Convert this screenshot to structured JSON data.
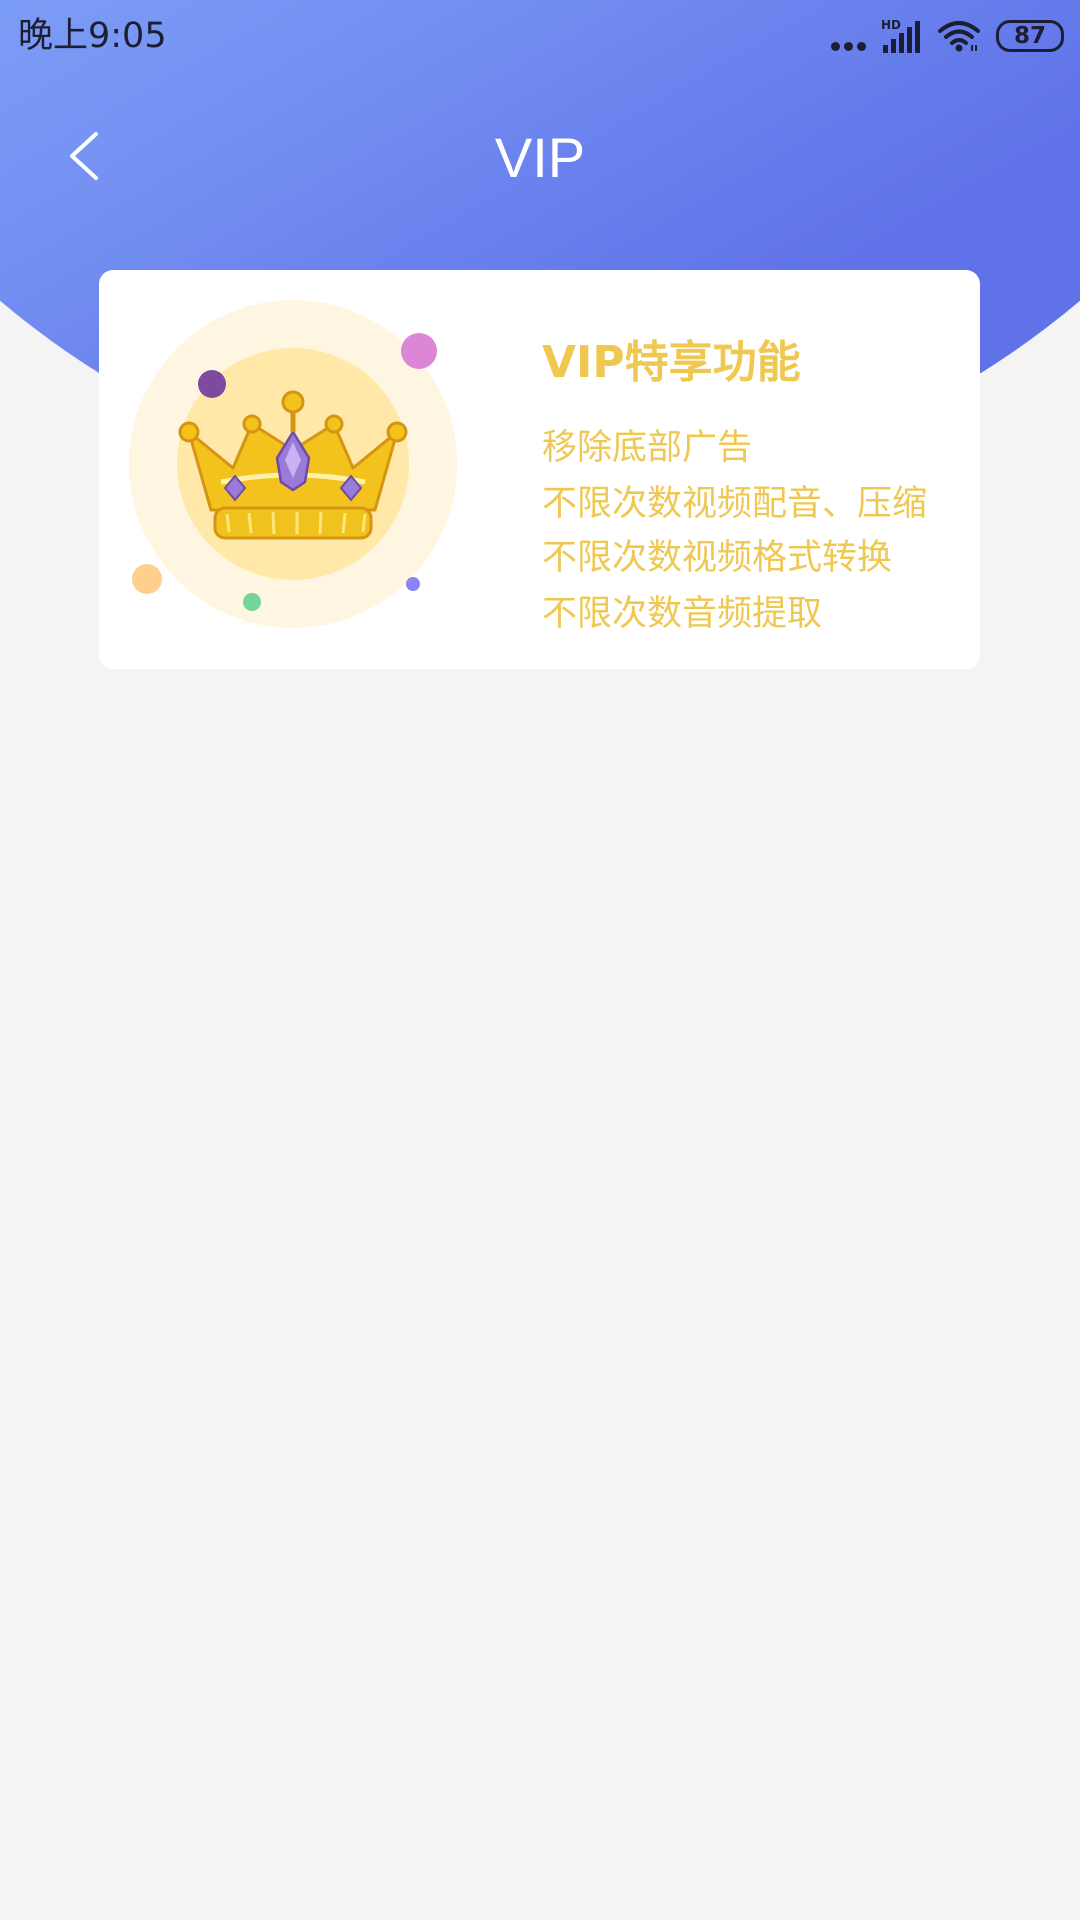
{
  "status_bar": {
    "time": "晚上9:05",
    "network_label": "HD",
    "battery_level": "87",
    "icons": [
      "more-dots-icon",
      "signal-icon",
      "wifi-icon",
      "battery-icon"
    ]
  },
  "nav": {
    "back_icon": "chevron-left-icon",
    "title": "VIP"
  },
  "vip_card": {
    "illustration": "crown-icon",
    "title": "VIP特享功能",
    "benefits": [
      "移除底部广告",
      "不限次数视频配音、压缩",
      "不限次数视频格式转换",
      "不限次数音频提取"
    ]
  },
  "colors": {
    "header_gradient_start": "#86aefb",
    "header_gradient_end": "#5f72e8",
    "accent_gold": "#efc852",
    "page_background": "#f4f4f4",
    "card_background": "#ffffff"
  }
}
